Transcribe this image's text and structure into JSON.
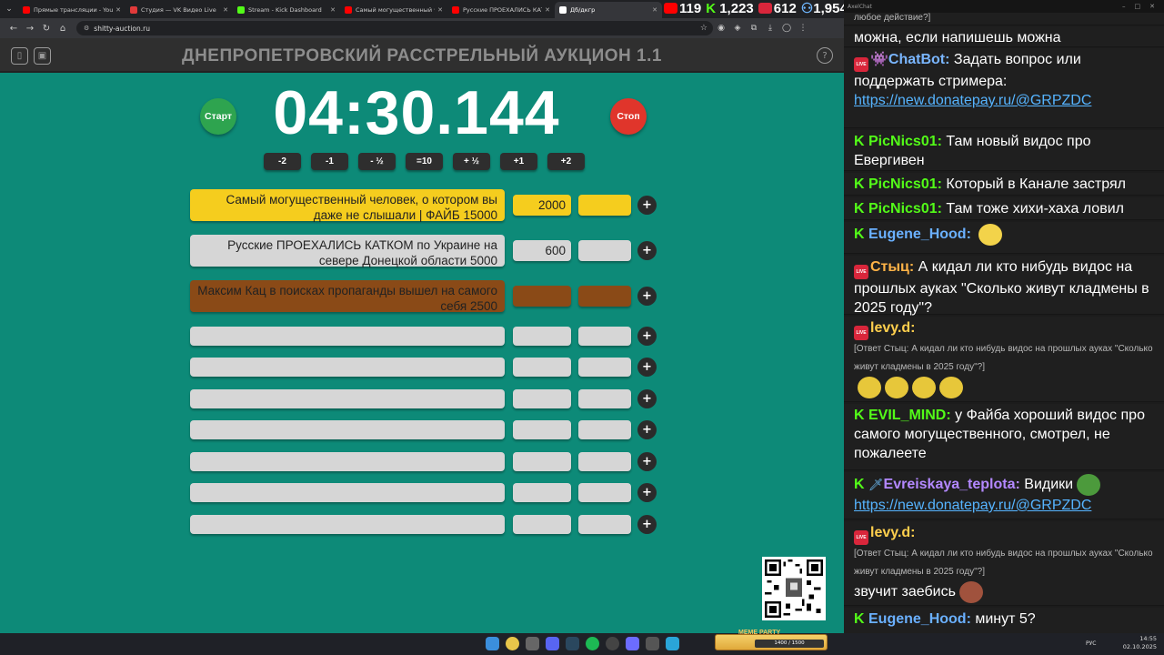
{
  "browser": {
    "tabs": [
      {
        "title": "Прямые трансляции - YouTube",
        "fav": "#ff0000"
      },
      {
        "title": "Студия — VK Видео Live",
        "fav": "#e23a3a"
      },
      {
        "title": "Stream - Kick Dashboard",
        "fav": "#53fc18"
      },
      {
        "title": "Самый могущественный человек",
        "fav": "#ff0000"
      },
      {
        "title": "Русские ПРОЕХАЛИСЬ КАТКОМ",
        "fav": "#ff0000"
      },
      {
        "title": "Дб/дкгр",
        "fav": "#ffffff"
      }
    ],
    "url": "shitty-auction.ru"
  },
  "app": {
    "title": "ДНЕПРОПЕТРОВСКИЙ РАССТРЕЛЬНЫЙ АУКЦИОН 1.1",
    "timer": "04:30.144",
    "start_label": "Старт",
    "stop_label": "Стоп",
    "adjust_buttons": [
      "-2",
      "-1",
      "- ½",
      "=10",
      "+ ½",
      "+1",
      "+2"
    ],
    "lots": [
      {
        "name": "Самый могущественный человек, о котором вы даже не слышали | ФАЙБ 15000",
        "value": "2000",
        "color": "gold"
      },
      {
        "name": "Русские ПРОЕХАЛИСЬ КАТКОМ по Украине на севере Донецкой области 5000",
        "value": "600",
        "color": "gray"
      },
      {
        "name": "Максим Кац в поисках пропаганды вышел на самого себя 2500",
        "value": "",
        "color": "brown"
      },
      {
        "name": "",
        "value": "",
        "color": "gray"
      },
      {
        "name": "",
        "value": "",
        "color": "gray"
      },
      {
        "name": "",
        "value": "",
        "color": "gray"
      },
      {
        "name": "",
        "value": "",
        "color": "gray"
      },
      {
        "name": "",
        "value": "",
        "color": "gray"
      },
      {
        "name": "",
        "value": "",
        "color": "gray"
      },
      {
        "name": "",
        "value": "",
        "color": "gray"
      }
    ],
    "plus_label": "+"
  },
  "stats": {
    "youtube": "119",
    "kick": "1,223",
    "vk": "612",
    "total": "1,954"
  },
  "chat": {
    "window_title": "AxelChat",
    "messages": [
      {
        "text": "любое действие?]",
        "platform": "",
        "small": true
      },
      {
        "text": "можна, если напишешь можна",
        "platform": ""
      },
      {
        "user": "ChatBot:",
        "user_color": "#7ab6ff",
        "platform": "live",
        "text": "Задать вопрос или поддержать стримера:",
        "link": "https://new.donatepay.ru/@GRPZDC"
      },
      {
        "user": "PicNics01:",
        "user_color": "#53fc18",
        "platform": "kick",
        "text": "Там новый видос про Евергивен"
      },
      {
        "user": "PicNics01:",
        "user_color": "#53fc18",
        "platform": "kick",
        "text": "Который в Канале застрял"
      },
      {
        "user": "PicNics01:",
        "user_color": "#53fc18",
        "platform": "kick",
        "text": "Там тоже хихи-хаха ловил"
      },
      {
        "user": "Eugene_Hood:",
        "user_color": "#6ab0ff",
        "platform": "kick",
        "text": ""
      },
      {
        "user": "Стыц:",
        "user_color": "#ffb347",
        "platform": "live",
        "text": "А кидал ли кто нибудь видос на прошлых ауках \"Сколько живут кладмены в 2025 году\"?"
      },
      {
        "user": "levy.d:",
        "user_color": "#ffcf4d",
        "platform": "live",
        "reply": "[Ответ Стыц: А кидал ли кто нибудь видос на прошлых ауках \"Сколько живут кладмены в 2025 году\"?]",
        "text": ""
      },
      {
        "user": "EVIL_MIND:",
        "user_color": "#53fc18",
        "platform": "kick",
        "text": "у Файба хороший видос про самого могущественного, смотрел, не пожалеете"
      },
      {
        "user": "Evreiskaya_teplota:",
        "user_color": "#b388ff",
        "platform": "kick",
        "text": "Видики",
        "link": "https://new.donatepay.ru/@GRPZDC"
      },
      {
        "user": "levy.d:",
        "user_color": "#ffcf4d",
        "platform": "live",
        "reply": "[Ответ Стыц: А кидал ли кто нибудь видос на прошлых ауках \"Сколько живут кладмены в 2025 году\"?]",
        "text": "звучит заебись"
      },
      {
        "user": "Eugene_Hood:",
        "user_color": "#6ab0ff",
        "platform": "kick",
        "text": "минут 5?"
      }
    ]
  },
  "taskbar": {
    "lang": "РУС",
    "time": "14:55",
    "date": "02.10.2025",
    "meme_title": "MEME PARTY",
    "meme_progress": "1400 / 1500"
  }
}
